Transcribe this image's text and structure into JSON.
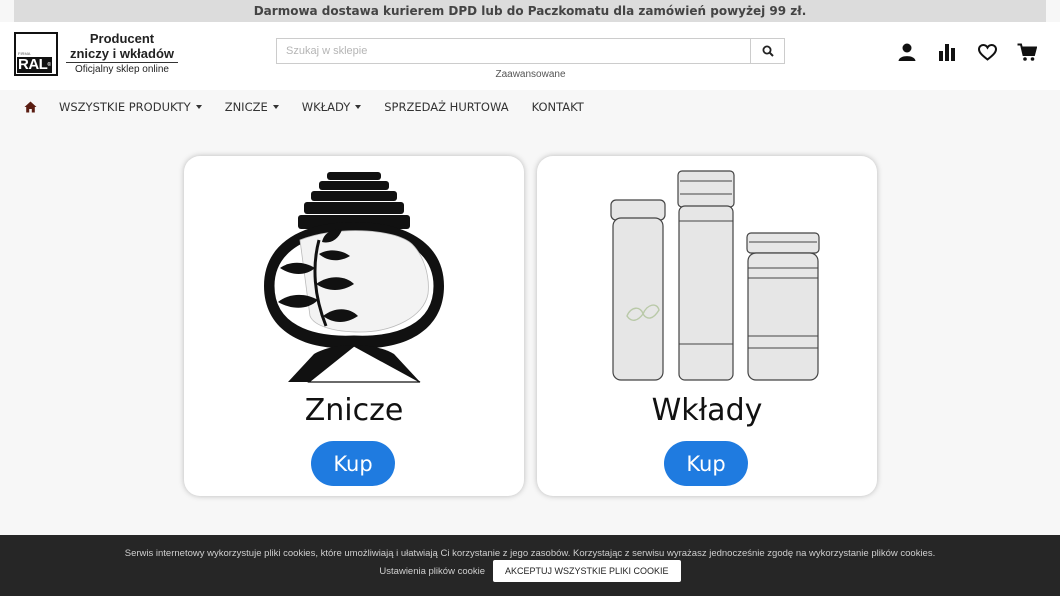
{
  "topbar": {
    "text": "Darmowa dostawa kurierem DPD lub do Paczkomatu dla zamówień powyżej 99 zł."
  },
  "logo": {
    "brand": "RAL",
    "small": "FIRMA",
    "line1": "Producent",
    "line2": "zniczy i wkładów",
    "line3": "Oficjalny sklep online"
  },
  "search": {
    "placeholder": "Szukaj w sklepie",
    "value": "",
    "advanced": "Zaawansowane",
    "button_icon": "search-icon"
  },
  "header_icons": [
    "user-icon",
    "compare-chart-icon",
    "heart-icon",
    "cart-icon"
  ],
  "nav": {
    "home_icon": "home-icon",
    "items": [
      {
        "label": "WSZYSTKIE PRODUKTY",
        "dropdown": true
      },
      {
        "label": "ZNICZE",
        "dropdown": true
      },
      {
        "label": "WKŁADY",
        "dropdown": true
      },
      {
        "label": "SPRZEDAŻ HURTOWA",
        "dropdown": false
      },
      {
        "label": "KONTAKT",
        "dropdown": false
      }
    ]
  },
  "cards": [
    {
      "title": "Znicze",
      "button": "Kup"
    },
    {
      "title": "Wkłady",
      "button": "Kup"
    }
  ],
  "cookie": {
    "message": "Serwis internetowy wykorzystuje pliki cookies, które umożliwiają i ułatwiają Ci korzystanie z jego zasobów. Korzystając z serwisu wyrażasz jednocześnie zgodę na wykorzystanie plików cookies.",
    "settings": "Ustawienia plików cookie",
    "accept": "AKCEPTUJ WSZYSTKIE PLIKI COOKIE"
  },
  "colors": {
    "buy_button": "#1f7be0",
    "cookie_bar": "#262626",
    "topbar": "#dcdcdc"
  }
}
